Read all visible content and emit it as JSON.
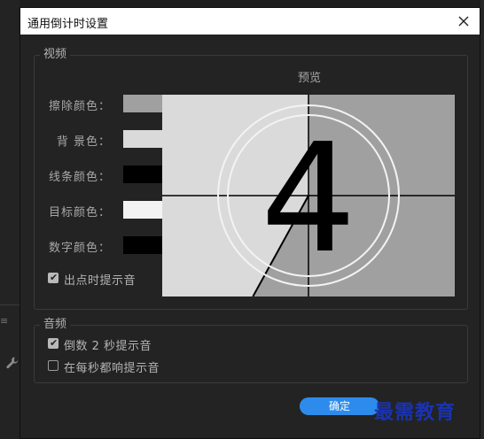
{
  "dialog": {
    "title": "通用倒计时设置",
    "ok_label": "确定"
  },
  "video": {
    "legend": "视频",
    "preview_label": "预览",
    "colors": [
      {
        "label": "擦除颜色：",
        "value": "#a0a0a0"
      },
      {
        "label": "背 景色：",
        "value": "#dadada"
      },
      {
        "label": "线条颜色：",
        "value": "#000000"
      },
      {
        "label": "目标颜色：",
        "value": "#f3f3f3"
      },
      {
        "label": "数字颜色：",
        "value": "#000000"
      }
    ],
    "cue_at_out_label": "出点时提示音",
    "cue_at_out_checked": true,
    "preview": {
      "digit": "4",
      "wipe_color": "#a0a0a0",
      "background_color": "#dadada",
      "line_color": "#000000",
      "target_color": "#f3f3f3",
      "digit_color": "#000000",
      "wipe_fraction": 0.58
    }
  },
  "audio": {
    "legend": "音频",
    "options": [
      {
        "label": "倒数 2 秒提示音",
        "checked": true
      },
      {
        "label": "在每秒都响提示音",
        "checked": false
      }
    ]
  },
  "watermark": "最需教育",
  "background": {
    "menu_icon": "hamburger-icon",
    "tool_icon": "wrench-icon"
  }
}
